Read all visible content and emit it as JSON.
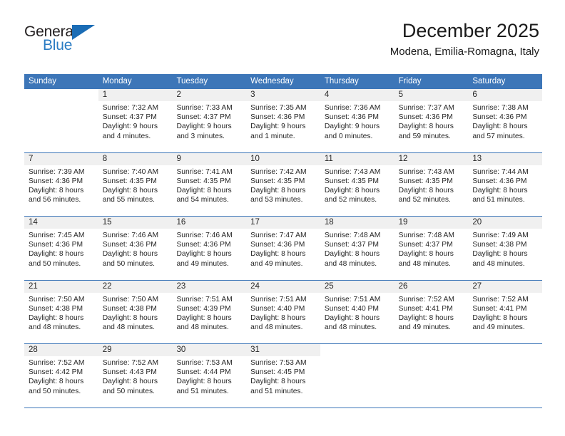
{
  "brand": {
    "name_top": "General",
    "name_bottom": "Blue",
    "triangle_color": "#1a6cb5",
    "text_color": "#231f20",
    "blue_color": "#2b7cc3"
  },
  "header": {
    "title": "December 2025",
    "subtitle": "Modena, Emilia-Romagna, Italy"
  },
  "theme": {
    "header_blue": "#3d76b8",
    "day_band": "#f0f0f0",
    "text": "#262626"
  },
  "calendar": {
    "weekdays": [
      "Sunday",
      "Monday",
      "Tuesday",
      "Wednesday",
      "Thursday",
      "Friday",
      "Saturday"
    ],
    "labels": {
      "sunrise": "Sunrise:",
      "sunset": "Sunset:",
      "daylight": "Daylight:"
    },
    "weeks": [
      [
        {
          "day": "",
          "sunrise": "",
          "sunset": "",
          "daylight_1": "",
          "daylight_2": ""
        },
        {
          "day": "1",
          "sunrise": "Sunrise: 7:32 AM",
          "sunset": "Sunset: 4:37 PM",
          "daylight_1": "Daylight: 9 hours",
          "daylight_2": "and 4 minutes."
        },
        {
          "day": "2",
          "sunrise": "Sunrise: 7:33 AM",
          "sunset": "Sunset: 4:37 PM",
          "daylight_1": "Daylight: 9 hours",
          "daylight_2": "and 3 minutes."
        },
        {
          "day": "3",
          "sunrise": "Sunrise: 7:35 AM",
          "sunset": "Sunset: 4:36 PM",
          "daylight_1": "Daylight: 9 hours",
          "daylight_2": "and 1 minute."
        },
        {
          "day": "4",
          "sunrise": "Sunrise: 7:36 AM",
          "sunset": "Sunset: 4:36 PM",
          "daylight_1": "Daylight: 9 hours",
          "daylight_2": "and 0 minutes."
        },
        {
          "day": "5",
          "sunrise": "Sunrise: 7:37 AM",
          "sunset": "Sunset: 4:36 PM",
          "daylight_1": "Daylight: 8 hours",
          "daylight_2": "and 59 minutes."
        },
        {
          "day": "6",
          "sunrise": "Sunrise: 7:38 AM",
          "sunset": "Sunset: 4:36 PM",
          "daylight_1": "Daylight: 8 hours",
          "daylight_2": "and 57 minutes."
        }
      ],
      [
        {
          "day": "7",
          "sunrise": "Sunrise: 7:39 AM",
          "sunset": "Sunset: 4:36 PM",
          "daylight_1": "Daylight: 8 hours",
          "daylight_2": "and 56 minutes."
        },
        {
          "day": "8",
          "sunrise": "Sunrise: 7:40 AM",
          "sunset": "Sunset: 4:35 PM",
          "daylight_1": "Daylight: 8 hours",
          "daylight_2": "and 55 minutes."
        },
        {
          "day": "9",
          "sunrise": "Sunrise: 7:41 AM",
          "sunset": "Sunset: 4:35 PM",
          "daylight_1": "Daylight: 8 hours",
          "daylight_2": "and 54 minutes."
        },
        {
          "day": "10",
          "sunrise": "Sunrise: 7:42 AM",
          "sunset": "Sunset: 4:35 PM",
          "daylight_1": "Daylight: 8 hours",
          "daylight_2": "and 53 minutes."
        },
        {
          "day": "11",
          "sunrise": "Sunrise: 7:43 AM",
          "sunset": "Sunset: 4:35 PM",
          "daylight_1": "Daylight: 8 hours",
          "daylight_2": "and 52 minutes."
        },
        {
          "day": "12",
          "sunrise": "Sunrise: 7:43 AM",
          "sunset": "Sunset: 4:35 PM",
          "daylight_1": "Daylight: 8 hours",
          "daylight_2": "and 52 minutes."
        },
        {
          "day": "13",
          "sunrise": "Sunrise: 7:44 AM",
          "sunset": "Sunset: 4:36 PM",
          "daylight_1": "Daylight: 8 hours",
          "daylight_2": "and 51 minutes."
        }
      ],
      [
        {
          "day": "14",
          "sunrise": "Sunrise: 7:45 AM",
          "sunset": "Sunset: 4:36 PM",
          "daylight_1": "Daylight: 8 hours",
          "daylight_2": "and 50 minutes."
        },
        {
          "day": "15",
          "sunrise": "Sunrise: 7:46 AM",
          "sunset": "Sunset: 4:36 PM",
          "daylight_1": "Daylight: 8 hours",
          "daylight_2": "and 50 minutes."
        },
        {
          "day": "16",
          "sunrise": "Sunrise: 7:46 AM",
          "sunset": "Sunset: 4:36 PM",
          "daylight_1": "Daylight: 8 hours",
          "daylight_2": "and 49 minutes."
        },
        {
          "day": "17",
          "sunrise": "Sunrise: 7:47 AM",
          "sunset": "Sunset: 4:36 PM",
          "daylight_1": "Daylight: 8 hours",
          "daylight_2": "and 49 minutes."
        },
        {
          "day": "18",
          "sunrise": "Sunrise: 7:48 AM",
          "sunset": "Sunset: 4:37 PM",
          "daylight_1": "Daylight: 8 hours",
          "daylight_2": "and 48 minutes."
        },
        {
          "day": "19",
          "sunrise": "Sunrise: 7:48 AM",
          "sunset": "Sunset: 4:37 PM",
          "daylight_1": "Daylight: 8 hours",
          "daylight_2": "and 48 minutes."
        },
        {
          "day": "20",
          "sunrise": "Sunrise: 7:49 AM",
          "sunset": "Sunset: 4:38 PM",
          "daylight_1": "Daylight: 8 hours",
          "daylight_2": "and 48 minutes."
        }
      ],
      [
        {
          "day": "21",
          "sunrise": "Sunrise: 7:50 AM",
          "sunset": "Sunset: 4:38 PM",
          "daylight_1": "Daylight: 8 hours",
          "daylight_2": "and 48 minutes."
        },
        {
          "day": "22",
          "sunrise": "Sunrise: 7:50 AM",
          "sunset": "Sunset: 4:38 PM",
          "daylight_1": "Daylight: 8 hours",
          "daylight_2": "and 48 minutes."
        },
        {
          "day": "23",
          "sunrise": "Sunrise: 7:51 AM",
          "sunset": "Sunset: 4:39 PM",
          "daylight_1": "Daylight: 8 hours",
          "daylight_2": "and 48 minutes."
        },
        {
          "day": "24",
          "sunrise": "Sunrise: 7:51 AM",
          "sunset": "Sunset: 4:40 PM",
          "daylight_1": "Daylight: 8 hours",
          "daylight_2": "and 48 minutes."
        },
        {
          "day": "25",
          "sunrise": "Sunrise: 7:51 AM",
          "sunset": "Sunset: 4:40 PM",
          "daylight_1": "Daylight: 8 hours",
          "daylight_2": "and 48 minutes."
        },
        {
          "day": "26",
          "sunrise": "Sunrise: 7:52 AM",
          "sunset": "Sunset: 4:41 PM",
          "daylight_1": "Daylight: 8 hours",
          "daylight_2": "and 49 minutes."
        },
        {
          "day": "27",
          "sunrise": "Sunrise: 7:52 AM",
          "sunset": "Sunset: 4:41 PM",
          "daylight_1": "Daylight: 8 hours",
          "daylight_2": "and 49 minutes."
        }
      ],
      [
        {
          "day": "28",
          "sunrise": "Sunrise: 7:52 AM",
          "sunset": "Sunset: 4:42 PM",
          "daylight_1": "Daylight: 8 hours",
          "daylight_2": "and 50 minutes."
        },
        {
          "day": "29",
          "sunrise": "Sunrise: 7:52 AM",
          "sunset": "Sunset: 4:43 PM",
          "daylight_1": "Daylight: 8 hours",
          "daylight_2": "and 50 minutes."
        },
        {
          "day": "30",
          "sunrise": "Sunrise: 7:53 AM",
          "sunset": "Sunset: 4:44 PM",
          "daylight_1": "Daylight: 8 hours",
          "daylight_2": "and 51 minutes."
        },
        {
          "day": "31",
          "sunrise": "Sunrise: 7:53 AM",
          "sunset": "Sunset: 4:45 PM",
          "daylight_1": "Daylight: 8 hours",
          "daylight_2": "and 51 minutes."
        },
        {
          "day": "",
          "sunrise": "",
          "sunset": "",
          "daylight_1": "",
          "daylight_2": ""
        },
        {
          "day": "",
          "sunrise": "",
          "sunset": "",
          "daylight_1": "",
          "daylight_2": ""
        },
        {
          "day": "",
          "sunrise": "",
          "sunset": "",
          "daylight_1": "",
          "daylight_2": ""
        }
      ]
    ]
  }
}
